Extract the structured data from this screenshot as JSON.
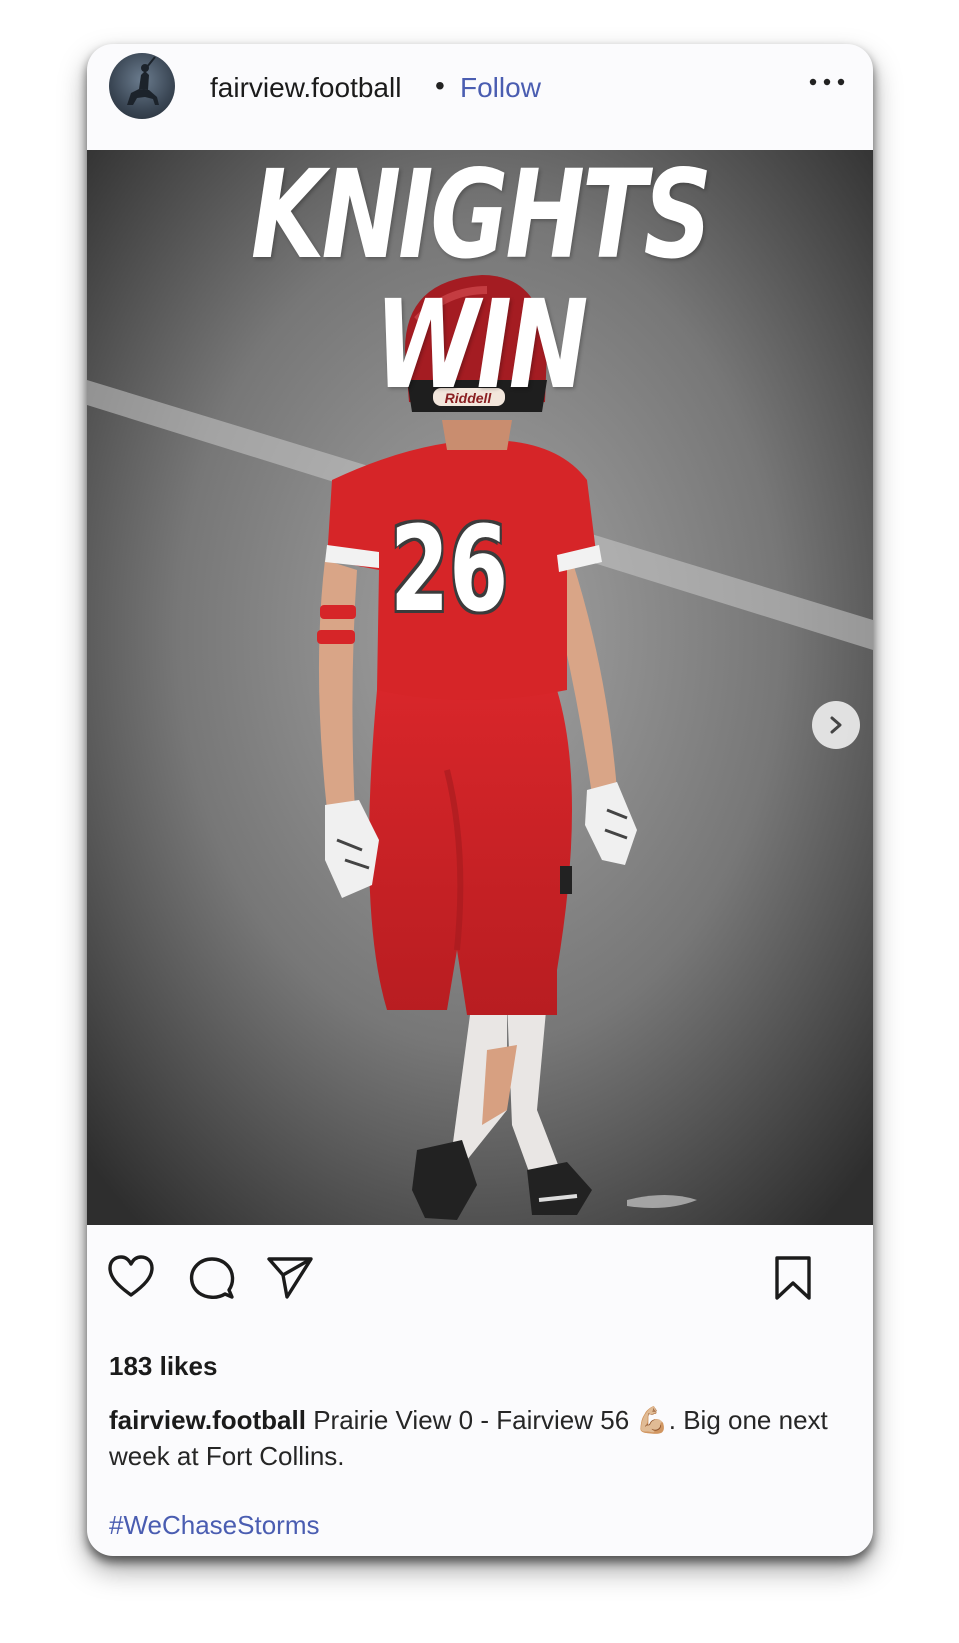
{
  "post": {
    "username": "fairview.football",
    "separator": "•",
    "follow_label": "Follow",
    "more_icon": "more-horizontal-icon"
  },
  "media": {
    "headline": "KNIGHTS WIN",
    "jersey_number": "26",
    "helmet_brand": "Riddell",
    "next_icon": "chevron-right-icon"
  },
  "actions": {
    "like_icon": "heart-icon",
    "comment_icon": "comment-icon",
    "share_icon": "send-icon",
    "save_icon": "bookmark-icon"
  },
  "likes": "183 likes",
  "caption": {
    "username": "fairview.football",
    "text": " Prairie View 0 - Fairview 56 💪🏼. Big one next week at Fort Collins."
  },
  "hashtag": "#WeChaseStorms",
  "colors": {
    "link": "#4a5db1",
    "jersey_red": "#d62528",
    "card_bg": "#fbfbfd"
  }
}
